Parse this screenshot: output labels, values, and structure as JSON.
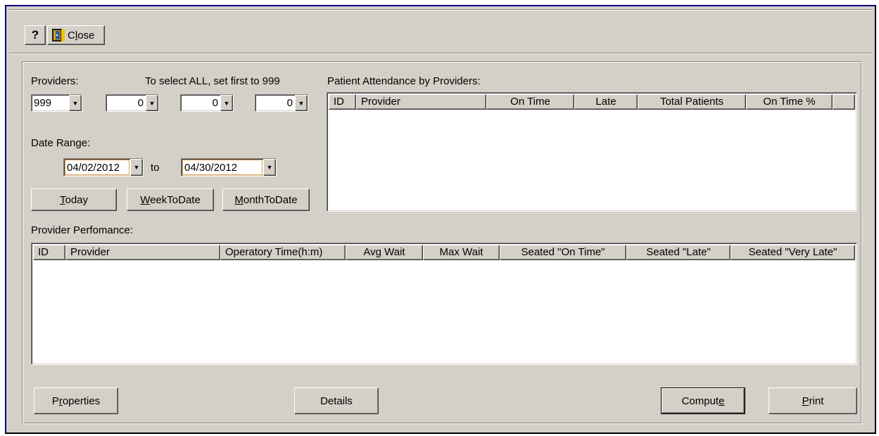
{
  "toolbar": {
    "help_label": "?",
    "close_label": "Close",
    "close_mnemonic_prefix": "C",
    "close_mnemonic_char": "l",
    "close_mnemonic_rest": "ose",
    "close_icon": "door-exit-icon"
  },
  "providers": {
    "label": "Providers:",
    "hint": "To select ALL, set first to 999",
    "values": [
      "999",
      "0",
      "0",
      "0"
    ]
  },
  "date_range": {
    "label": "Date Range:",
    "from": "04/02/2012",
    "to_label": "to",
    "to": "04/30/2012"
  },
  "quick_buttons": [
    {
      "mnemonic": "T",
      "rest": "oday"
    },
    {
      "mnemonic": "W",
      "rest": "eekToDate"
    },
    {
      "mnemonic": "M",
      "rest": "onthToDate"
    }
  ],
  "attendance": {
    "title": "Patient Attendance by Providers:",
    "columns": [
      "ID",
      "Provider",
      "On Time",
      "Late",
      "Total Patients",
      "On Time %"
    ],
    "rows": []
  },
  "performance": {
    "title": "Provider Perfomance:",
    "columns": [
      "ID",
      "Provider",
      "Operatory Time(h:m)",
      "Avg Wait",
      "Max Wait",
      "Seated \"On Time\"",
      "Seated \"Late\"",
      "Seated \"Very Late\""
    ],
    "rows": []
  },
  "bottom_buttons": {
    "properties": {
      "prefix": "P",
      "mnemonic": "r",
      "rest": "operties"
    },
    "details": "Details",
    "compute": {
      "prefix": "Comput",
      "mnemonic": "e",
      "rest": ""
    },
    "print": {
      "prefix": "",
      "mnemonic": "P",
      "rest": "rint"
    }
  },
  "colors": {
    "face": "#d4d0c8",
    "window_border": "#000080",
    "date_focus_border": "#e0a040"
  }
}
